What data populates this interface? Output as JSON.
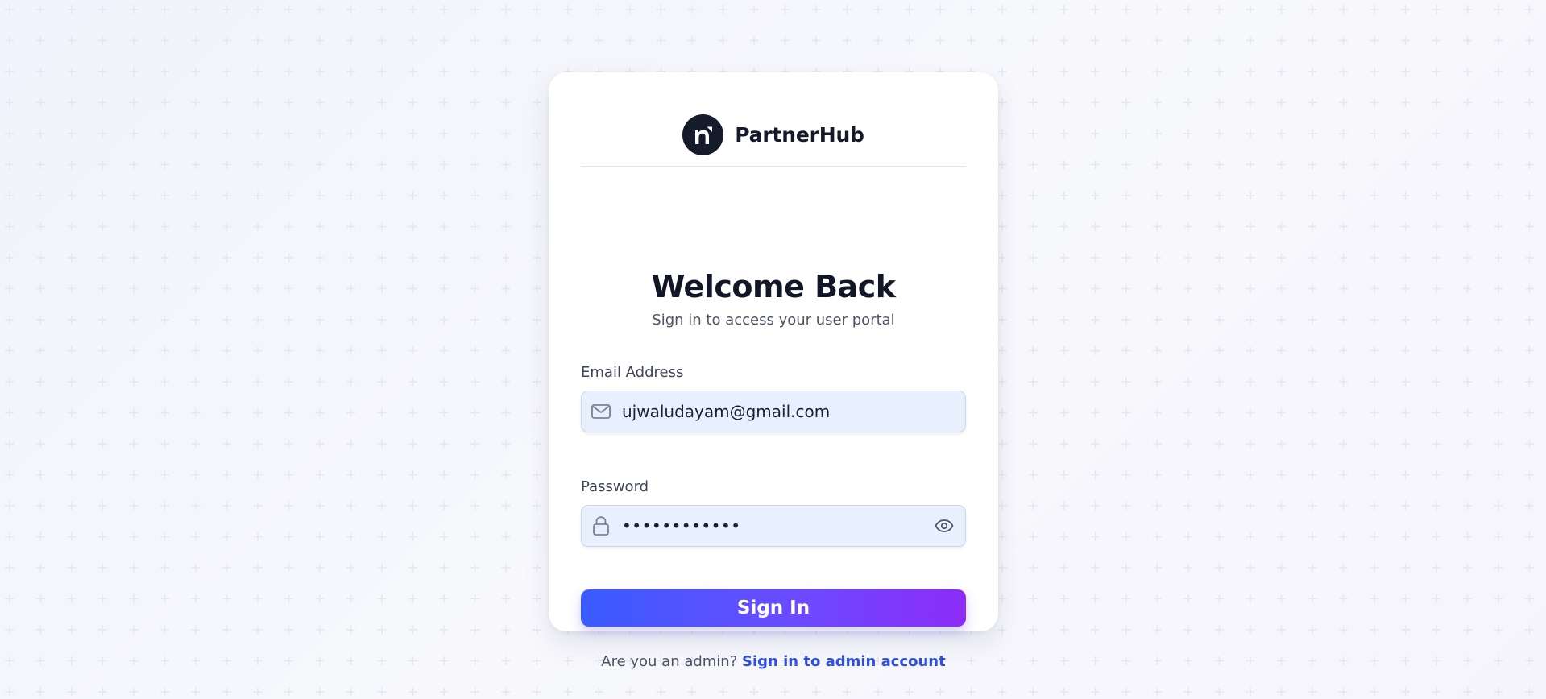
{
  "brand": {
    "name": "PartnerHub",
    "logo_letter": "n"
  },
  "heading": {
    "title": "Welcome Back",
    "subtitle": "Sign in to access your user portal"
  },
  "form": {
    "email": {
      "label": "Email Address",
      "value": "ujwaludayam@gmail.com",
      "icon": "mail-icon"
    },
    "password": {
      "label": "Password",
      "value_masked": "••••••••••••",
      "icon": "lock-icon",
      "toggle_icon": "eye-icon"
    },
    "submit_label": "Sign In"
  },
  "footer": {
    "prompt": "Are you an admin?",
    "link_label": "Sign in to admin account"
  },
  "colors": {
    "accent_start": "#3a5cff",
    "accent_end": "#8d2cf6",
    "link": "#2f4fe0",
    "input_bg": "#e8effd",
    "logo_bg": "#151b2b"
  }
}
